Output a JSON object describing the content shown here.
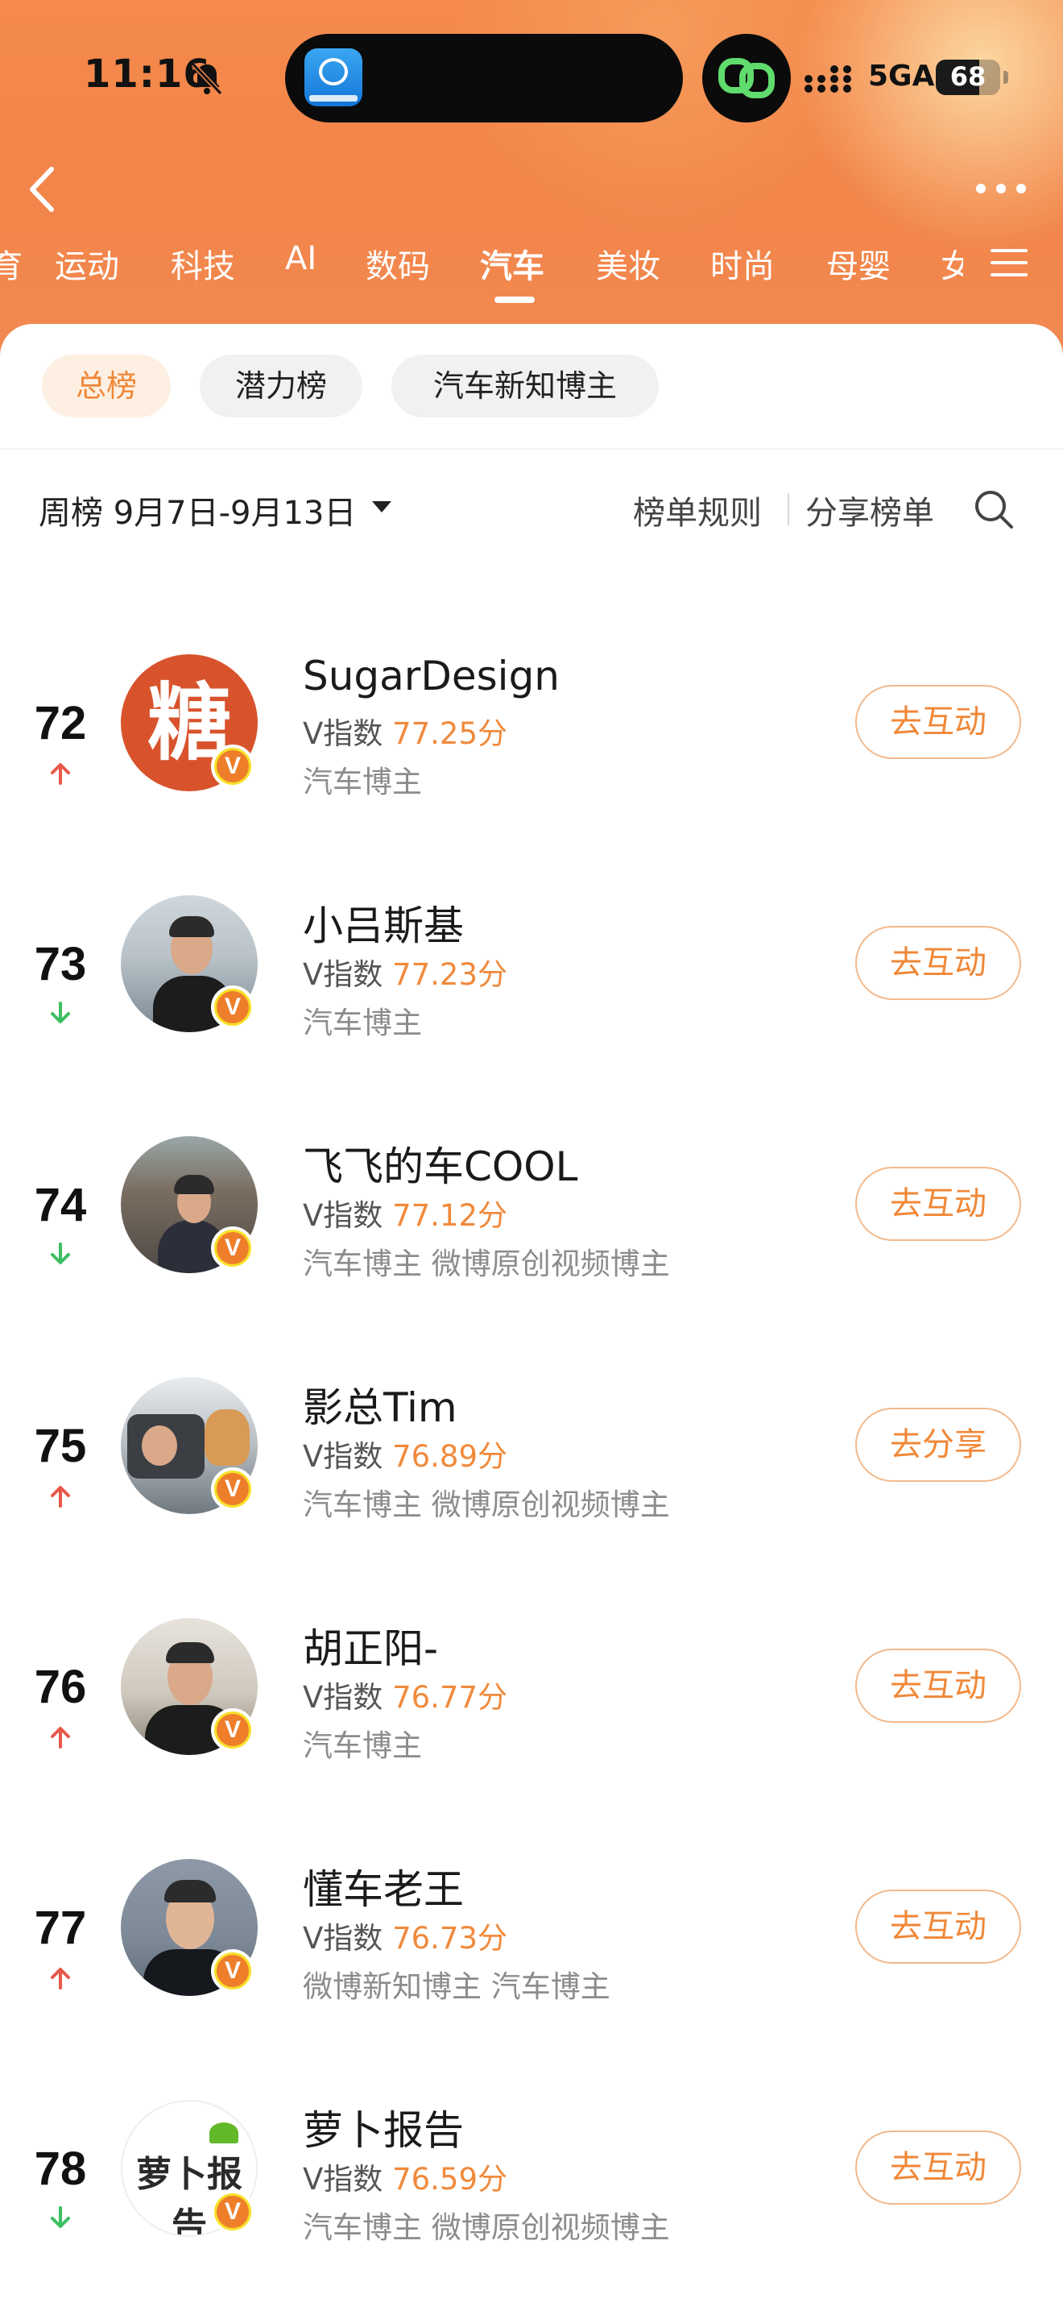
{
  "status_bar": {
    "time": "11:16",
    "network": "5GA",
    "battery": "68",
    "battery_level": 0.68
  },
  "category_tabs": {
    "items": [
      "运动",
      "科技",
      "AI",
      "数码",
      "汽车",
      "美妆",
      "时尚",
      "母婴"
    ],
    "active": "汽车"
  },
  "sub_tabs": {
    "items": [
      "总榜",
      "潜力榜",
      "汽车新知博主"
    ],
    "active": "总榜"
  },
  "toolbar": {
    "period": "周榜 9月7日-9月13日",
    "rules": "榜单规则",
    "share": "分享榜单"
  },
  "rankings": [
    {
      "rank": "72",
      "trend": "up",
      "name": "SugarDesign",
      "vindex_label": "V指数",
      "vindex_value": "77.25分",
      "tags": "汽车博主",
      "action": "去互动",
      "avatar_glyph": "糖"
    },
    {
      "rank": "73",
      "trend": "down",
      "name": "小吕斯基",
      "vindex_label": "V指数",
      "vindex_value": "77.23分",
      "tags": "汽车博主",
      "action": "去互动"
    },
    {
      "rank": "74",
      "trend": "down",
      "name": "飞飞的车COOL",
      "vindex_label": "V指数",
      "vindex_value": "77.12分",
      "tags": "汽车博主 微博原创视频博主",
      "action": "去互动"
    },
    {
      "rank": "75",
      "trend": "up",
      "name": "影总Tim",
      "vindex_label": "V指数",
      "vindex_value": "76.89分",
      "tags": "汽车博主 微博原创视频博主",
      "action": "去分享"
    },
    {
      "rank": "76",
      "trend": "up",
      "name": "胡正阳-",
      "vindex_label": "V指数",
      "vindex_value": "76.77分",
      "tags": "汽车博主",
      "action": "去互动"
    },
    {
      "rank": "77",
      "trend": "up",
      "name": "懂车老王",
      "vindex_label": "V指数",
      "vindex_value": "76.73分",
      "tags": "微博新知博主 汽车博主",
      "action": "去互动"
    },
    {
      "rank": "78",
      "trend": "down",
      "name": "萝卜报告",
      "vindex_label": "V指数",
      "vindex_value": "76.59分",
      "tags": "汽车博主 微博原创视频博主",
      "action": "去互动",
      "avatar_glyph": "萝卜报告"
    }
  ],
  "badge_letter": "V",
  "colors": {
    "accent": "#f08838",
    "trend_up": "#e8584a",
    "trend_down": "#3cbf62",
    "header": "#f2854a"
  }
}
